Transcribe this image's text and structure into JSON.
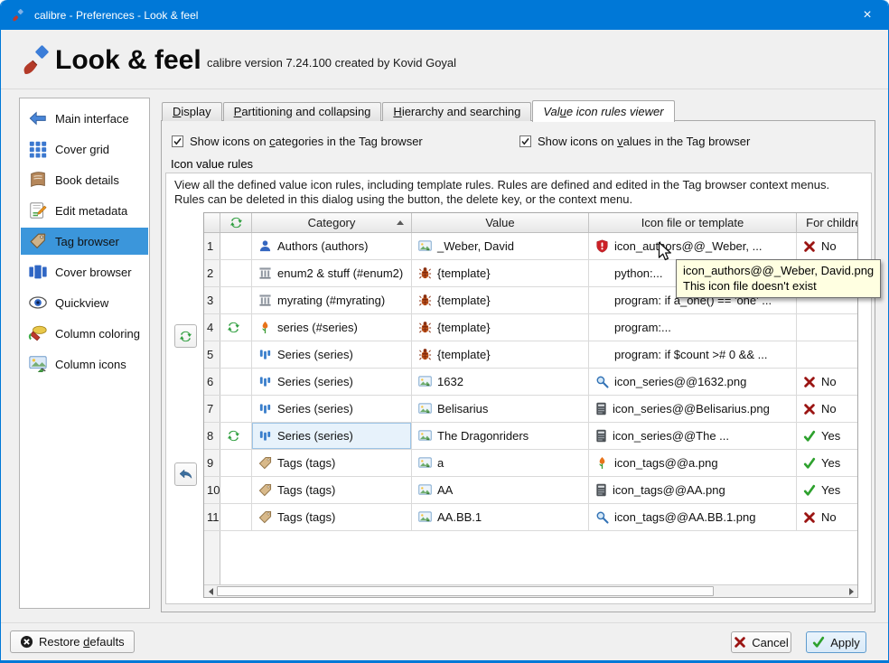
{
  "colors": {
    "titlebar_blue": "#0078d7",
    "sidebar_selection_blue": "#3b96db",
    "tooltip_yellow": "#ffffe1",
    "yes_green": "#2ea12e",
    "no_red": "#9b1513",
    "error_red": "#cc2127"
  },
  "window": {
    "title": "calibre - Preferences - Look & feel",
    "close_glyph": "×"
  },
  "header": {
    "title": "Look & feel",
    "subtitle": "calibre version 7.24.100 created by Kovid Goyal"
  },
  "sidebar": {
    "items": [
      {
        "label": "Main interface",
        "icon": "main-interface-icon"
      },
      {
        "label": "Cover grid",
        "icon": "cover-grid-icon"
      },
      {
        "label": "Book details",
        "icon": "book-details-icon"
      },
      {
        "label": "Edit metadata",
        "icon": "edit-metadata-icon"
      },
      {
        "label": "Tag browser",
        "icon": "tag-browser-icon",
        "selected": true
      },
      {
        "label": "Cover browser",
        "icon": "cover-browser-icon"
      },
      {
        "label": "Quickview",
        "icon": "quickview-icon"
      },
      {
        "label": "Column coloring",
        "icon": "column-coloring-icon"
      },
      {
        "label": "Column icons",
        "icon": "column-icons-icon"
      }
    ]
  },
  "tabs": [
    {
      "label": "&Display"
    },
    {
      "label": "&Partitioning and collapsing"
    },
    {
      "label": "&Hierarchy and searching"
    },
    {
      "label": "Val&ue icon rules viewer",
      "active": true
    }
  ],
  "checkboxes": [
    {
      "label": "Show icons on &categories in the Tag browser",
      "checked": true
    },
    {
      "label": "Show icons on &values in the Tag browser",
      "checked": true
    }
  ],
  "group": {
    "title": "Icon value rules",
    "description_line1": "View all the defined value icon rules, including template rules. Rules are defined and edited in the Tag browser context menus.",
    "description_line2": "Rules can be deleted in this dialog using the button, the delete key, or the context menu."
  },
  "table": {
    "headers": {
      "category": "Category",
      "value": "Value",
      "icon_file": "Icon file or template",
      "for_children": "For children",
      "sort_column": "Category",
      "sort_direction": "ascending"
    },
    "rows": [
      {
        "num": "1",
        "recycled": false,
        "category": {
          "icon": "author-icon",
          "label": "Authors (authors)"
        },
        "value": {
          "icon": "image-icon",
          "label": "_Weber, David"
        },
        "file": {
          "icon": "error-shield-icon",
          "label": "icon_authors@@_Weber, ..."
        },
        "children": {
          "icon": "no-icon",
          "label": "No"
        }
      },
      {
        "num": "2",
        "recycled": false,
        "category": {
          "icon": "column-icon",
          "label": "enum2 & stuff (#enum2)"
        },
        "value": {
          "icon": "bug-icon",
          "label": "{template}"
        },
        "file": {
          "icon": null,
          "label": "python:..."
        },
        "children": null
      },
      {
        "num": "3",
        "recycled": false,
        "category": {
          "icon": "column-icon",
          "label": "myrating (#myrating)"
        },
        "value": {
          "icon": "bug-icon",
          "label": "{template}"
        },
        "file": {
          "icon": null,
          "label": "program: if a_one() == 'one' ..."
        },
        "children": null
      },
      {
        "num": "4",
        "recycled": true,
        "category": {
          "icon": "flower-icon",
          "label": "series (#series)"
        },
        "value": {
          "icon": "bug-icon",
          "label": "{template}"
        },
        "file": {
          "icon": null,
          "label": "program:..."
        },
        "children": null
      },
      {
        "num": "5",
        "recycled": false,
        "category": {
          "icon": "series-icon",
          "label": "Series (series)"
        },
        "value": {
          "icon": "bug-icon",
          "label": "{template}"
        },
        "file": {
          "icon": null,
          "label": "program: if $count ># 0 && ..."
        },
        "children": null
      },
      {
        "num": "6",
        "recycled": false,
        "category": {
          "icon": "series-icon",
          "label": "Series (series)"
        },
        "value": {
          "icon": "image-icon",
          "label": "1632"
        },
        "file": {
          "icon": "search-icon",
          "label": "icon_series@@1632.png"
        },
        "children": {
          "icon": "no-icon",
          "label": "No"
        }
      },
      {
        "num": "7",
        "recycled": false,
        "category": {
          "icon": "series-icon",
          "label": "Series (series)"
        },
        "value": {
          "icon": "image-icon",
          "label": "Belisarius"
        },
        "file": {
          "icon": "template-file-icon",
          "label": "icon_series@@Belisarius.png"
        },
        "children": {
          "icon": "no-icon",
          "label": "No"
        }
      },
      {
        "num": "8",
        "recycled": true,
        "category": {
          "icon": "series-icon",
          "label": "Series (series)",
          "selected": true
        },
        "value": {
          "icon": "image-icon",
          "label": "The Dragonriders"
        },
        "file": {
          "icon": "template-file-icon",
          "label": "icon_series@@The ..."
        },
        "children": {
          "icon": "yes-icon",
          "label": "Yes"
        }
      },
      {
        "num": "9",
        "recycled": false,
        "category": {
          "icon": "tag-icon",
          "label": "Tags (tags)"
        },
        "value": {
          "icon": "image-icon",
          "label": "a"
        },
        "file": {
          "icon": "flower-icon",
          "label": "icon_tags@@a.png"
        },
        "children": {
          "icon": "yes-icon",
          "label": "Yes"
        }
      },
      {
        "num": "10",
        "recycled": false,
        "category": {
          "icon": "tag-icon",
          "label": "Tags (tags)"
        },
        "value": {
          "icon": "image-icon",
          "label": "AA"
        },
        "file": {
          "icon": "template-file-icon",
          "label": "icon_tags@@AA.png"
        },
        "children": {
          "icon": "yes-icon",
          "label": "Yes"
        }
      },
      {
        "num": "11",
        "recycled": false,
        "category": {
          "icon": "tag-icon",
          "label": "Tags (tags)"
        },
        "value": {
          "icon": "image-icon",
          "label": "AA.BB.1"
        },
        "file": {
          "icon": "search-icon",
          "label": "icon_tags@@AA.BB.1.png"
        },
        "children": {
          "icon": "no-icon",
          "label": "No"
        }
      }
    ]
  },
  "tooltip": {
    "line1": "icon_authors@@_Weber, David.png",
    "line2": "This icon file doesn't exist"
  },
  "footer": {
    "restore_label": "Restore &defaults",
    "cancel_label": "Cancel",
    "apply_label": "Apply"
  }
}
